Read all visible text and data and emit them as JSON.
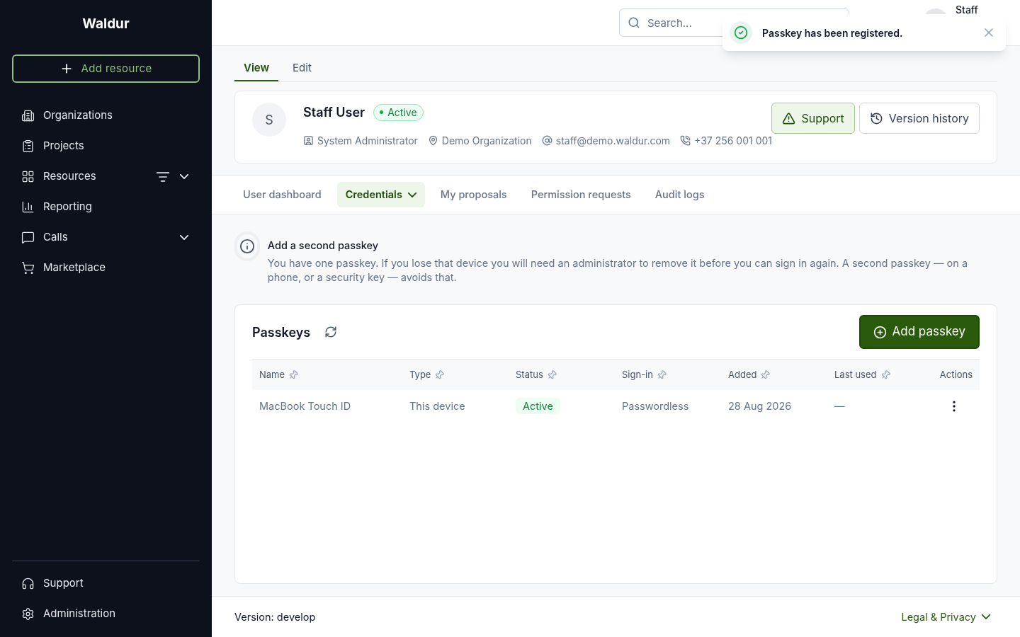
{
  "sidebar": {
    "brand": "Waldur",
    "add_button": "Add resource",
    "items": [
      {
        "label": "Organizations",
        "kind": "building"
      },
      {
        "label": "Projects",
        "kind": "clipboard"
      },
      {
        "label": "Resources",
        "kind": "grid",
        "filter": true,
        "expandable": true
      },
      {
        "label": "Reporting",
        "kind": "chart"
      },
      {
        "label": "Calls",
        "kind": "chat",
        "expandable": true
      },
      {
        "label": "Marketplace",
        "kind": "cart"
      }
    ],
    "bottom_items": [
      {
        "label": "Support",
        "kind": "headset"
      },
      {
        "label": "Administration",
        "kind": "gear"
      }
    ]
  },
  "header": {
    "search": {
      "placeholder": "Search..."
    },
    "user_name": "Staff"
  },
  "toast": {
    "message": "Passkey has been registered."
  },
  "page_tabs": [
    {
      "label": "View",
      "selected": true
    },
    {
      "label": "Edit",
      "selected": false
    }
  ],
  "profile": {
    "initial": "S",
    "name": "Staff User",
    "status": "Active",
    "details": [
      {
        "kind": "role",
        "text": "System Administrator"
      },
      {
        "kind": "location",
        "text": "Demo Organization"
      },
      {
        "kind": "email",
        "text": "staff@demo.waldur.com"
      },
      {
        "kind": "phone",
        "text": "+37 256 001 001"
      }
    ],
    "buttons": [
      {
        "label": "Support",
        "kind": "warning"
      },
      {
        "label": "Version history",
        "kind": "history"
      }
    ]
  },
  "section_tabs": [
    {
      "label": "User dashboard",
      "selected": false,
      "dropdown": false
    },
    {
      "label": "Credentials",
      "selected": true,
      "dropdown": true
    },
    {
      "label": "My proposals",
      "selected": false,
      "dropdown": false
    },
    {
      "label": "Permission requests",
      "selected": false,
      "dropdown": false
    },
    {
      "label": "Audit logs",
      "selected": false,
      "dropdown": false
    }
  ],
  "notice": {
    "title": "Add a second passkey",
    "text": "You have one passkey. If you lose that device you will need an administrator to remove it before you can sign in again. A second passkey — on a phone, or a security key — avoids that."
  },
  "passkeys": {
    "title": "Passkeys",
    "add_button": "Add passkey",
    "columns": [
      {
        "label": "Name",
        "pinnable": true
      },
      {
        "label": "Type",
        "pinnable": true
      },
      {
        "label": "Status",
        "pinnable": true
      },
      {
        "label": "Sign-in",
        "pinnable": true
      },
      {
        "label": "Added",
        "pinnable": true
      },
      {
        "label": "Last used",
        "pinnable": true
      },
      {
        "label": "Actions",
        "pinnable": false
      }
    ],
    "rows": [
      {
        "name": "MacBook Touch ID",
        "type": "This device",
        "status": "Active",
        "sign_in": "Passwordless",
        "added": "28 Aug 2026",
        "last_used": "—"
      }
    ]
  },
  "footer": {
    "version": "Version: develop",
    "legal": "Legal & Privacy"
  }
}
